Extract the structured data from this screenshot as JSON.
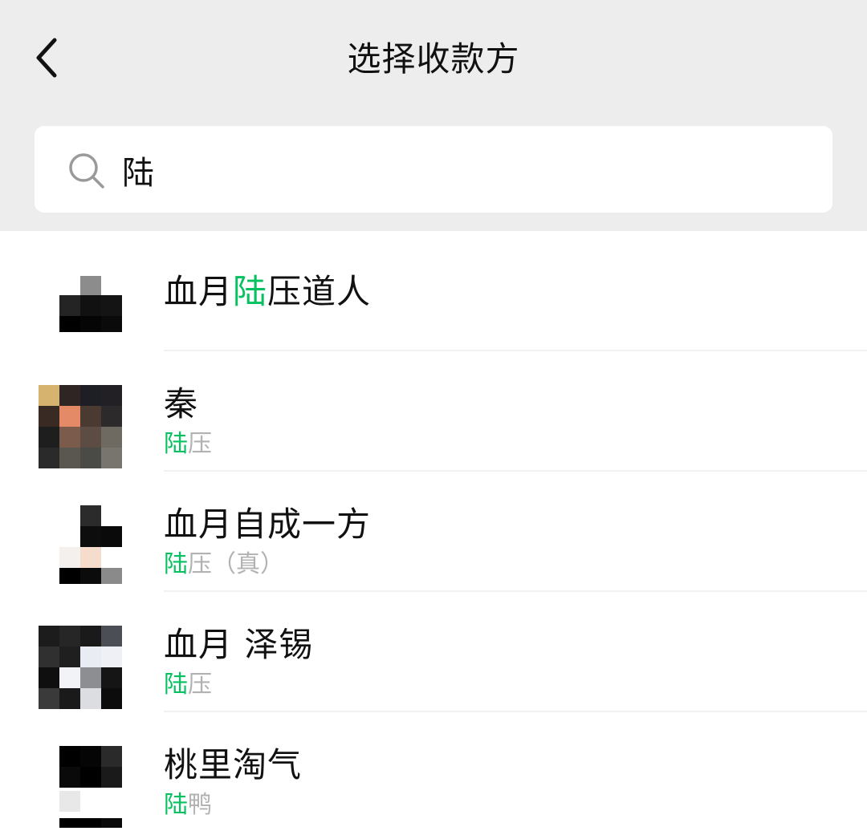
{
  "header": {
    "title": "选择收款方",
    "back_icon": "chevron-left-icon"
  },
  "search": {
    "icon": "search-icon",
    "value": "陆",
    "highlight_color": "#07c160"
  },
  "results": [
    {
      "name_before": "血月",
      "name_match": "陆",
      "name_after": "压道人",
      "sub_match": "",
      "sub_after": ""
    },
    {
      "name_before": "秦",
      "name_match": "",
      "name_after": "",
      "sub_match": "陆",
      "sub_after": "压"
    },
    {
      "name_before": "血月自成一方",
      "name_match": "",
      "name_after": "",
      "sub_match": "陆",
      "sub_after": "压（真）"
    },
    {
      "name_before": "血月 泽锡",
      "name_match": "",
      "name_after": "",
      "sub_match": "陆",
      "sub_after": "压"
    },
    {
      "name_before": "桃里淘气",
      "name_match": "",
      "name_after": "",
      "sub_match": "陆",
      "sub_after": "鸭"
    }
  ]
}
